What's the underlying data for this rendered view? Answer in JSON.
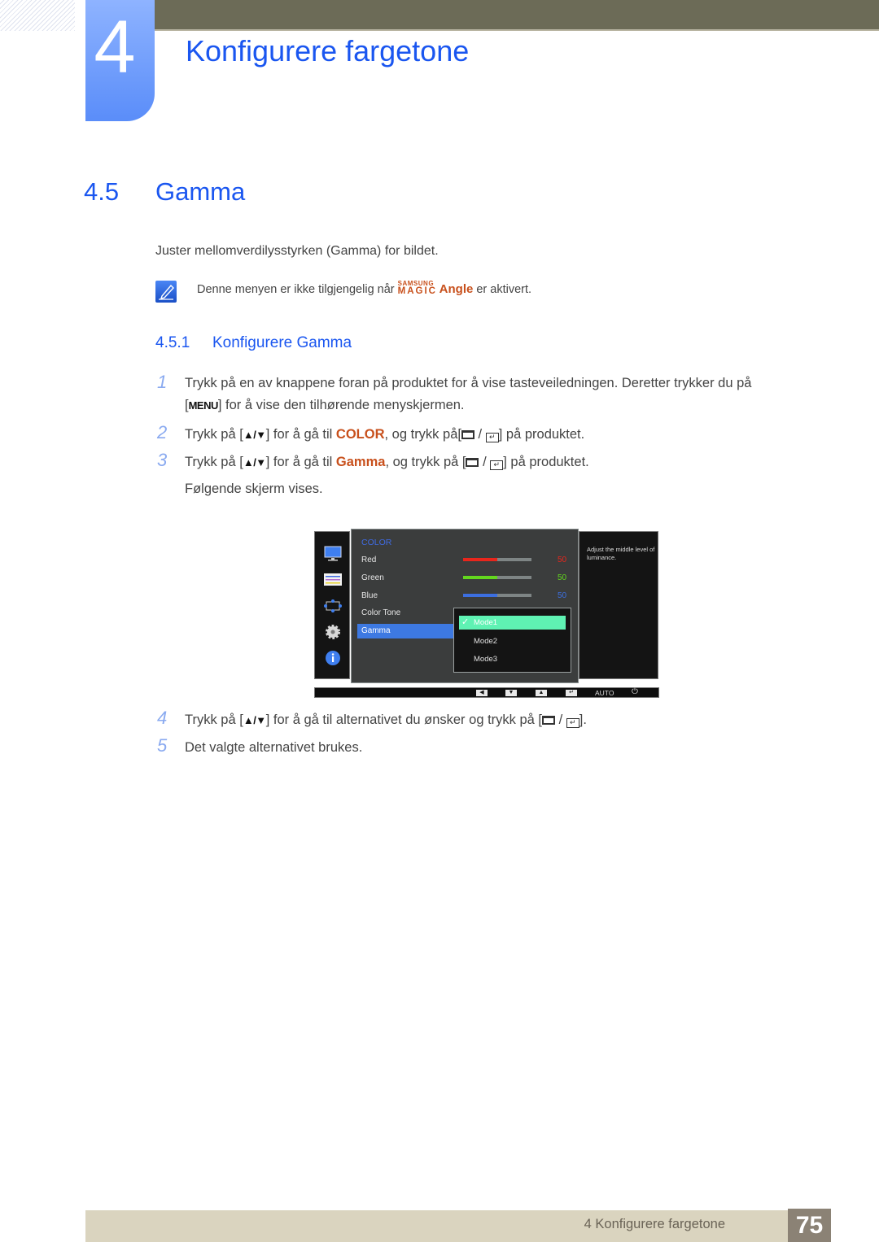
{
  "header": {
    "chapter_number": "4",
    "chapter_title": "Konfigurere fargetone"
  },
  "section": {
    "number": "4.5",
    "title": "Gamma",
    "intro": "Juster mellomverdilysstyrken (Gamma) for bildet.",
    "note": {
      "icon": "note-pencil-icon",
      "before": "Denne menyen er ikke tilgjengelig når ",
      "brand_top": "SAMSUNG",
      "brand_bottom": "MAGIC",
      "brand_word": "Angle",
      "after": " er aktivert."
    }
  },
  "subsection": {
    "number": "4.5.1",
    "title": "Konfigurere Gamma"
  },
  "steps": [
    {
      "num": "1",
      "line1": "Trykk på en av knappene foran på produktet for å vise tasteveiledningen. Deretter trykker du på",
      "line2_key": "MENU",
      "line2_rest": "] for å vise den tilhørende menyskjermen."
    },
    {
      "num": "2",
      "pre": "Trykk på [",
      "arrows": "▲/▼",
      "mid": "] for å gå til ",
      "highlight": "COLOR",
      "post": ", og trykk på[",
      "end": "] på produktet."
    },
    {
      "num": "3",
      "pre": "Trykk på [",
      "arrows": "▲/▼",
      "mid": "] for å gå til ",
      "highlight": "Gamma",
      "post": ", og trykk på [",
      "end": "] på produktet.",
      "line2": "Følgende skjerm vises."
    },
    {
      "num": "4",
      "pre": "Trykk på [",
      "arrows": "▲/▼",
      "mid": "] for å gå til alternativet du ønsker og trykk på [",
      "end": "]."
    },
    {
      "num": "5",
      "text": "Det valgte alternativet brukes."
    }
  ],
  "osd": {
    "heading": "COLOR",
    "items": [
      {
        "label": "Red",
        "value": "50",
        "percent": 50,
        "color": "#e8261c"
      },
      {
        "label": "Green",
        "value": "50",
        "percent": 50,
        "color": "#63d71e"
      },
      {
        "label": "Blue",
        "value": "50",
        "percent": 50,
        "color": "#3c6fe0"
      },
      {
        "label": "Color Tone"
      },
      {
        "label": "Gamma",
        "selected": true
      }
    ],
    "options": [
      {
        "label": "Mode1",
        "checked": true
      },
      {
        "label": "Mode2"
      },
      {
        "label": "Mode3"
      }
    ],
    "help": "Adjust the middle level of luminance.",
    "side_icons": [
      "picture-icon",
      "onscreen-display-icon",
      "size-position-icon",
      "settings-gear-icon",
      "information-icon"
    ],
    "bottom_keys": [
      "◀",
      "▼",
      "▲",
      "↵"
    ],
    "auto_label": "AUTO",
    "power_symbol": "⏻"
  },
  "footer": {
    "chapter": "4 Konfigurere fargetone",
    "page": "75"
  }
}
